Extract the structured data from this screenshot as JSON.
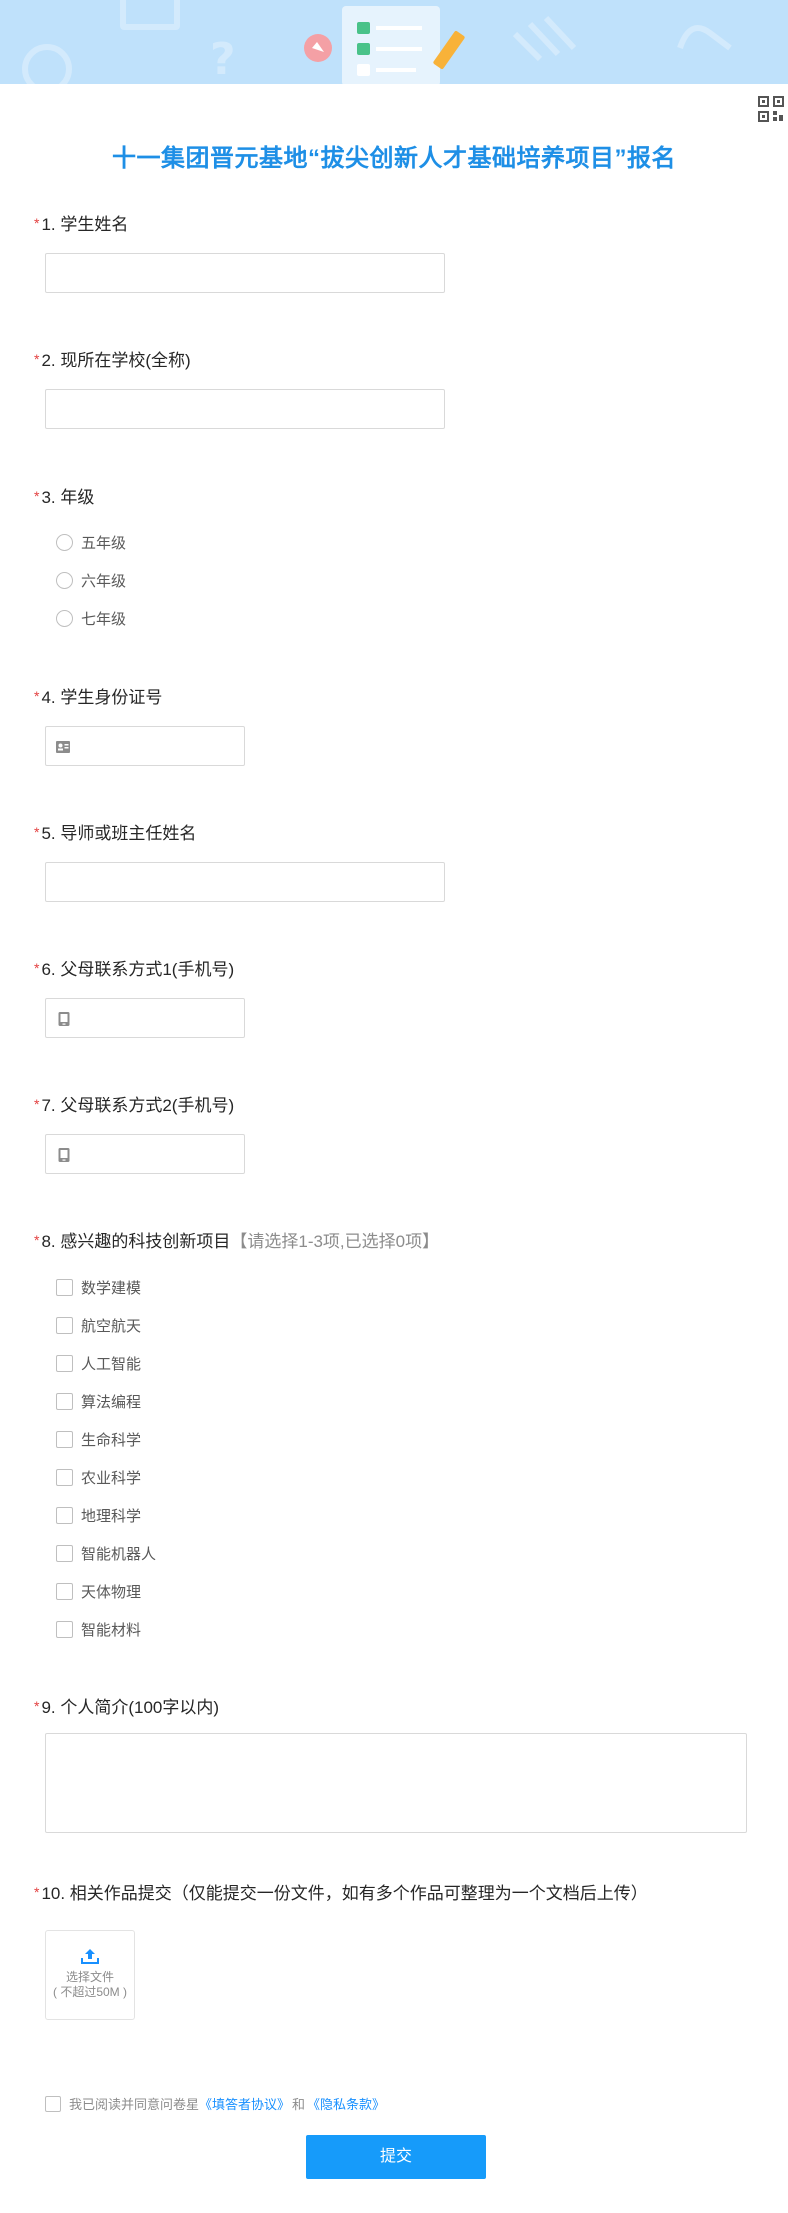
{
  "form_title": "十一集团晋元基地“拔尖创新人才基础培养项目”报名",
  "required_mark": "*",
  "q1": {
    "label": "1. 学生姓名",
    "value": ""
  },
  "q2": {
    "label": "2. 现所在学校(全称)",
    "value": ""
  },
  "q3": {
    "label": "3. 年级",
    "options": [
      "五年级",
      "六年级",
      "七年级"
    ]
  },
  "q4": {
    "label": "4. 学生身份证号",
    "value": "",
    "icon": "id-card-icon"
  },
  "q5": {
    "label": "5. 导师或班主任姓名",
    "value": ""
  },
  "q6": {
    "label": "6. 父母联系方式1(手机号)",
    "value": "",
    "icon": "phone-icon"
  },
  "q7": {
    "label": "7. 父母联系方式2(手机号)",
    "value": "",
    "icon": "phone-icon"
  },
  "q8": {
    "label": "8. 感兴趣的科技创新项目",
    "hint": "【请选择1-3项,已选择0项】",
    "options": [
      "数学建模",
      "航空航天",
      "人工智能",
      "算法编程",
      "生命科学",
      "农业科学",
      "地理科学",
      "智能机器人",
      "天体物理",
      "智能材料"
    ]
  },
  "q9": {
    "label": "9. 个人简介(100字以内)",
    "value": ""
  },
  "q10": {
    "label": "10. 相关作品提交（仅能提交一份文件，如有多个作品可整理为一个文档后上传）",
    "upload_label": "选择文件",
    "upload_limit": "( 不超过50M )",
    "upload_icon": "upload-icon"
  },
  "agreement": {
    "prefix": "我已阅读并同意问卷星",
    "link1": "《填答者协议》",
    "and": "和",
    "link2": "《隐私条款》"
  },
  "submit_label": "提交",
  "colors": {
    "accent": "#1e8fe6",
    "button": "#169bfa",
    "required": "#e34040",
    "banner": "#bfe1fb"
  }
}
